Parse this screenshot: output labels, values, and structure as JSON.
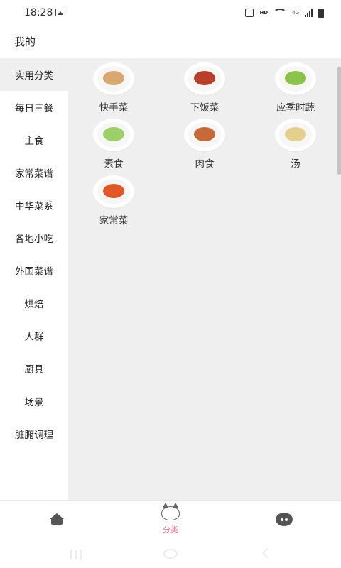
{
  "status": {
    "time": "18:28",
    "hd": "HD",
    "network": "4G"
  },
  "header": {
    "title": "我的"
  },
  "sidebar": {
    "items": [
      {
        "label": "实用分类",
        "active": true
      },
      {
        "label": "每日三餐"
      },
      {
        "label": "主食"
      },
      {
        "label": "家常菜谱"
      },
      {
        "label": "中华菜系"
      },
      {
        "label": "各地小吃"
      },
      {
        "label": "外国菜谱"
      },
      {
        "label": "烘焙"
      },
      {
        "label": "人群"
      },
      {
        "label": "厨具"
      },
      {
        "label": "场景"
      },
      {
        "label": "脏腑调理"
      }
    ]
  },
  "categories": [
    {
      "label": "快手菜",
      "icon": "dish-noodles-icon",
      "color": "#d9a772"
    },
    {
      "label": "下饭菜",
      "icon": "dish-braised-meat-icon",
      "color": "#b8402a"
    },
    {
      "label": "应季时蔬",
      "icon": "dish-greens-icon",
      "color": "#8cc34a"
    },
    {
      "label": "素食",
      "icon": "dish-cucumber-icon",
      "color": "#9ccf67"
    },
    {
      "label": "肉食",
      "icon": "dish-meat-icon",
      "color": "#c76a3a"
    },
    {
      "label": "汤",
      "icon": "dish-soup-icon",
      "color": "#e5cf8e"
    },
    {
      "label": "家常菜",
      "icon": "dish-tomato-egg-icon",
      "color": "#e0582a"
    }
  ],
  "tabbar": {
    "tabs": [
      {
        "label": "",
        "icon": "home-icon"
      },
      {
        "label": "分类",
        "icon": "cat-icon",
        "active": true
      },
      {
        "label": "",
        "icon": "message-icon"
      }
    ],
    "active_color": "#e87a8a"
  },
  "colors": {
    "content_bg": "#efefef",
    "accent": "#e87a8a"
  }
}
